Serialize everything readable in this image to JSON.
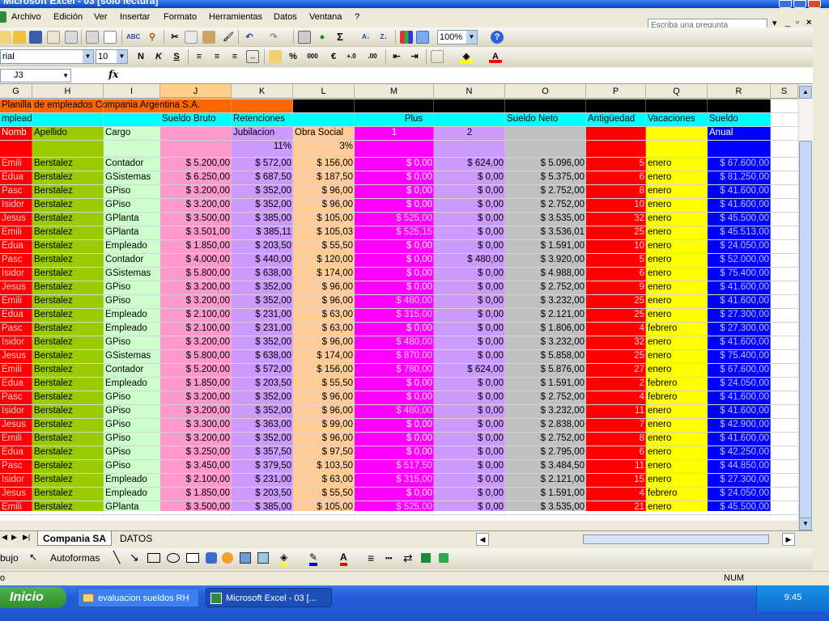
{
  "window": {
    "title": "Microsoft Excel - 03 [sólo lectura]"
  },
  "menu": [
    "Archivo",
    "Edición",
    "Ver",
    "Insertar",
    "Formato",
    "Herramientas",
    "Datos",
    "Ventana",
    "?"
  ],
  "ask_placeholder": "Escriba una pregunta",
  "toolbar": {
    "zoom": "100%",
    "font": "rial",
    "size": "10"
  },
  "formula": {
    "namebox": "J3",
    "fx": "fx",
    "content": ""
  },
  "columns": [
    "G",
    "H",
    "I",
    "J",
    "K",
    "L",
    "M",
    "N",
    "O",
    "P",
    "Q",
    "R",
    "S"
  ],
  "selected_column": "J",
  "header_rows": {
    "title": "Planilla de empleados Compania Argentina S.A.",
    "row2": {
      "G": "mpleado",
      "J": "Sueldo Bruto",
      "K": "Retenciones",
      "M": "Plus",
      "O": "Sueldo Neto",
      "P": "Antigüedad",
      "Q": "Vacaciones",
      "R": "Sueldo"
    },
    "row3": {
      "G": "Nomb",
      "H": "Apellido",
      "I": "Cargo",
      "K": "Jubilacion",
      "L": "Obra Social",
      "M": "1",
      "N": "2",
      "R": "Anual"
    },
    "row4": {
      "K": "11%",
      "L": "3%"
    }
  },
  "rows": [
    [
      "Emili",
      "Berstalez",
      "Contador",
      "$ 5.200,00",
      "$ 572,00",
      "$ 156,00",
      "$ 0,00",
      "$ 624,00",
      "$ 5.096,00",
      "5",
      "enero",
      "$ 67.600,00"
    ],
    [
      "Edua",
      "Berstalez",
      "GSistemas",
      "$ 6.250,00",
      "$ 687,50",
      "$ 187,50",
      "$ 0,00",
      "$ 0,00",
      "$ 5.375,00",
      "6",
      "enero",
      "$ 81.250,00"
    ],
    [
      "Pasc",
      "Berstalez",
      "GPiso",
      "$ 3.200,00",
      "$ 352,00",
      "$ 96,00",
      "$ 0,00",
      "$ 0,00",
      "$ 2.752,00",
      "8",
      "enero",
      "$ 41.600,00"
    ],
    [
      "Isidor",
      "Berstalez",
      "GPiso",
      "$ 3.200,00",
      "$ 352,00",
      "$ 96,00",
      "$ 0,00",
      "$ 0,00",
      "$ 2.752,00",
      "10",
      "enero",
      "$ 41.600,00"
    ],
    [
      "Jesus",
      "Berstalez",
      "GPlanta",
      "$ 3.500,00",
      "$ 385,00",
      "$ 105,00",
      "$ 525,00",
      "$ 0,00",
      "$ 3.535,00",
      "32",
      "enero",
      "$ 45.500,00"
    ],
    [
      "Emili",
      "Berstalez",
      "GPlanta",
      "$ 3.501,00",
      "$ 385,11",
      "$ 105,03",
      "$ 525,15",
      "$ 0,00",
      "$ 3.536,01",
      "25",
      "enero",
      "$ 45.513,00"
    ],
    [
      "Edua",
      "Berstalez",
      "Empleado",
      "$ 1.850,00",
      "$ 203,50",
      "$ 55,50",
      "$ 0,00",
      "$ 0,00",
      "$ 1.591,00",
      "10",
      "enero",
      "$ 24.050,00"
    ],
    [
      "Pasc",
      "Berstalez",
      "Contador",
      "$ 4.000,00",
      "$ 440,00",
      "$ 120,00",
      "$ 0,00",
      "$ 480,00",
      "$ 3.920,00",
      "5",
      "enero",
      "$ 52.000,00"
    ],
    [
      "Isidor",
      "Berstalez",
      "GSistemas",
      "$ 5.800,00",
      "$ 638,00",
      "$ 174,00",
      "$ 0,00",
      "$ 0,00",
      "$ 4.988,00",
      "6",
      "enero",
      "$ 75.400,00"
    ],
    [
      "Jesus",
      "Berstalez",
      "GPiso",
      "$ 3.200,00",
      "$ 352,00",
      "$ 96,00",
      "$ 0,00",
      "$ 0,00",
      "$ 2.752,00",
      "9",
      "enero",
      "$ 41.600,00"
    ],
    [
      "Emili",
      "Berstalez",
      "GPiso",
      "$ 3.200,00",
      "$ 352,00",
      "$ 96,00",
      "$ 480,00",
      "$ 0,00",
      "$ 3.232,00",
      "25",
      "enero",
      "$ 41.600,00"
    ],
    [
      "Edua",
      "Berstalez",
      "Empleado",
      "$ 2.100,00",
      "$ 231,00",
      "$ 63,00",
      "$ 315,00",
      "$ 0,00",
      "$ 2.121,00",
      "25",
      "enero",
      "$ 27.300,00"
    ],
    [
      "Pasc",
      "Berstalez",
      "Empleado",
      "$ 2.100,00",
      "$ 231,00",
      "$ 63,00",
      "$ 0,00",
      "$ 0,00",
      "$ 1.806,00",
      "4",
      "febrero",
      "$ 27.300,00"
    ],
    [
      "Isidor",
      "Berstalez",
      "GPiso",
      "$ 3.200,00",
      "$ 352,00",
      "$ 96,00",
      "$ 480,00",
      "$ 0,00",
      "$ 3.232,00",
      "32",
      "enero",
      "$ 41.600,00"
    ],
    [
      "Jesus",
      "Berstalez",
      "GSistemas",
      "$ 5.800,00",
      "$ 638,00",
      "$ 174,00",
      "$ 870,00",
      "$ 0,00",
      "$ 5.858,00",
      "25",
      "enero",
      "$ 75.400,00"
    ],
    [
      "Emili",
      "Berstalez",
      "Contador",
      "$ 5.200,00",
      "$ 572,00",
      "$ 156,00",
      "$ 780,00",
      "$ 624,00",
      "$ 5.876,00",
      "27",
      "enero",
      "$ 67.600,00"
    ],
    [
      "Edua",
      "Berstalez",
      "Empleado",
      "$ 1.850,00",
      "$ 203,50",
      "$ 55,50",
      "$ 0,00",
      "$ 0,00",
      "$ 1.591,00",
      "2",
      "febrero",
      "$ 24.050,00"
    ],
    [
      "Pasc",
      "Berstalez",
      "GPiso",
      "$ 3.200,00",
      "$ 352,00",
      "$ 96,00",
      "$ 0,00",
      "$ 0,00",
      "$ 2.752,00",
      "4",
      "febrero",
      "$ 41.600,00"
    ],
    [
      "Isidor",
      "Berstalez",
      "GPiso",
      "$ 3.200,00",
      "$ 352,00",
      "$ 96,00",
      "$ 480,00",
      "$ 0,00",
      "$ 3.232,00",
      "11",
      "enero",
      "$ 41.600,00"
    ],
    [
      "Jesus",
      "Berstalez",
      "GPiso",
      "$ 3.300,00",
      "$ 363,00",
      "$ 99,00",
      "$ 0,00",
      "$ 0,00",
      "$ 2.838,00",
      "7",
      "enero",
      "$ 42.900,00"
    ],
    [
      "Emili",
      "Berstalez",
      "GPiso",
      "$ 3.200,00",
      "$ 352,00",
      "$ 96,00",
      "$ 0,00",
      "$ 0,00",
      "$ 2.752,00",
      "8",
      "enero",
      "$ 41.600,00"
    ],
    [
      "Edua",
      "Berstalez",
      "GPiso",
      "$ 3.250,00",
      "$ 357,50",
      "$ 97,50",
      "$ 0,00",
      "$ 0,00",
      "$ 2.795,00",
      "6",
      "enero",
      "$ 42.250,00"
    ],
    [
      "Pasc",
      "Berstalez",
      "GPiso",
      "$ 3.450,00",
      "$ 379,50",
      "$ 103,50",
      "$ 517,50",
      "$ 0,00",
      "$ 3.484,50",
      "11",
      "enero",
      "$ 44.850,00"
    ],
    [
      "Isidor",
      "Berstalez",
      "Empleado",
      "$ 2.100,00",
      "$ 231,00",
      "$ 63,00",
      "$ 315,00",
      "$ 0,00",
      "$ 2.121,00",
      "15",
      "enero",
      "$ 27.300,00"
    ],
    [
      "Jesus",
      "Berstalez",
      "Empleado",
      "$ 1.850,00",
      "$ 203,50",
      "$ 55,50",
      "$ 0,00",
      "$ 0,00",
      "$ 1.591,00",
      "4",
      "febrero",
      "$ 24.050,00"
    ],
    [
      "Emili",
      "Berstalez",
      "GPlanta",
      "$ 3.500,00",
      "$ 385,00",
      "$ 105,00",
      "$ 525,00",
      "$ 0,00",
      "$ 3.535,00",
      "21",
      "enero",
      "$ 45.500,00"
    ]
  ],
  "colors": {
    "G": "#ff0000",
    "H": "#99cc00",
    "I": "#ccffcc",
    "J": "#ff99cc",
    "K": "#cc99ff",
    "L": "#ffcc99",
    "M": "#ff00ff",
    "N": "#cc99ff",
    "O": "#c0c0c0",
    "P": "#ff0000",
    "Q": "#ffff00",
    "R": "#0000ff",
    "title_bg": "#ff6600",
    "black_bar": "#000000",
    "header_bg": "#00ffff"
  },
  "sheet_tabs": [
    "Compania SA",
    "DATOS"
  ],
  "active_tab": "Compania SA",
  "drawbar": {
    "dibujo": "bujo",
    "autoformas": "Autoformas"
  },
  "status": {
    "left": "o",
    "num": "NUM"
  },
  "taskbar": {
    "start": "Inicio",
    "tasks": [
      "evaluacion sueldos RH",
      "Microsoft Excel - 03 [..."
    ],
    "clock": "9:45"
  }
}
